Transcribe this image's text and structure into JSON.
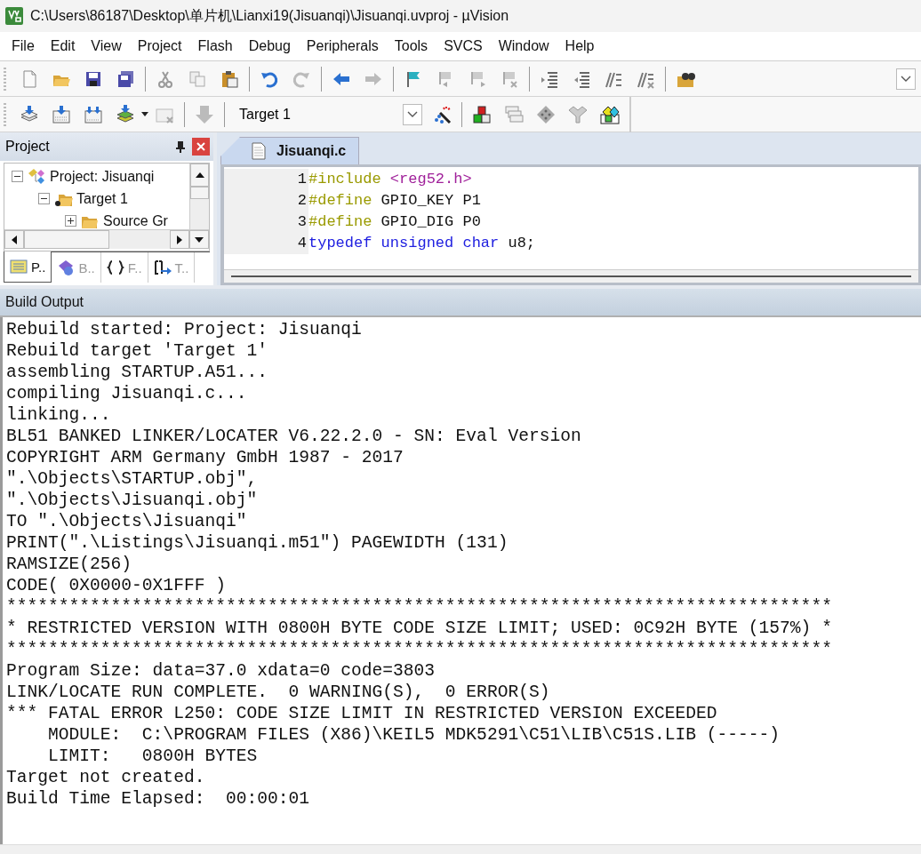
{
  "window": {
    "title": "C:\\Users\\86187\\Desktop\\单片机\\Lianxi19(Jisuanqi)\\Jisuanqi.uvproj - µVision"
  },
  "menu": [
    "File",
    "Edit",
    "View",
    "Project",
    "Flash",
    "Debug",
    "Peripherals",
    "Tools",
    "SVCS",
    "Window",
    "Help"
  ],
  "build_toolbar": {
    "target": "Target 1"
  },
  "project_panel": {
    "title": "Project",
    "tree": [
      {
        "label": "Project: Jisuanqi",
        "kind": "project",
        "expanded": true,
        "children": [
          {
            "label": "Target 1",
            "kind": "target",
            "expanded": true,
            "children": [
              {
                "label": "Source Gr",
                "kind": "group",
                "expanded": false
              }
            ]
          }
        ]
      }
    ],
    "tabs": [
      {
        "label": "P..",
        "kind": "project",
        "selected": true
      },
      {
        "label": "B..",
        "kind": "books",
        "selected": false
      },
      {
        "label": "F..",
        "kind": "functions",
        "selected": false
      },
      {
        "label": "T..",
        "kind": "templates",
        "selected": false
      }
    ]
  },
  "editor": {
    "tabs": [
      {
        "label": "Jisuanqi.c",
        "selected": true
      }
    ],
    "lines": [
      {
        "number": "1",
        "tokens": [
          {
            "text": "#include",
            "kind": "preprocessor"
          },
          {
            "text": " <reg52.h>",
            "kind": "string"
          }
        ]
      },
      {
        "number": "2",
        "tokens": [
          {
            "text": "#define",
            "kind": "preprocessor"
          },
          {
            "text": " GPIO_KEY P1",
            "kind": "plain"
          }
        ]
      },
      {
        "number": "3",
        "tokens": [
          {
            "text": "#define",
            "kind": "preprocessor"
          },
          {
            "text": " GPIO_DIG P0",
            "kind": "plain"
          }
        ]
      },
      {
        "number": "4",
        "tokens": [
          {
            "text": "typedef",
            "kind": "keyword"
          },
          {
            "text": " unsigned",
            "kind": "keyword"
          },
          {
            "text": " char",
            "kind": "keyword"
          },
          {
            "text": " u8;",
            "kind": "plain"
          }
        ]
      }
    ]
  },
  "build_output": {
    "title": "Build Output",
    "lines": [
      "Rebuild started: Project: Jisuanqi",
      "Rebuild target 'Target 1'",
      "assembling STARTUP.A51...",
      "compiling Jisuanqi.c...",
      "linking...",
      "BL51 BANKED LINKER/LOCATER V6.22.2.0 - SN: Eval Version",
      "COPYRIGHT ARM Germany GmbH 1987 - 2017",
      "\".\\Objects\\STARTUP.obj\",",
      "\".\\Objects\\Jisuanqi.obj\"",
      "TO \".\\Objects\\Jisuanqi\"",
      "PRINT(\".\\Listings\\Jisuanqi.m51\") PAGEWIDTH (131)",
      "RAMSIZE(256)",
      "CODE( 0X0000-0X1FFF )",
      "*******************************************************************************",
      "* RESTRICTED VERSION WITH 0800H BYTE CODE SIZE LIMIT; USED: 0C92H BYTE (157%) *",
      "*******************************************************************************",
      "Program Size: data=37.0 xdata=0 code=3803",
      "LINK/LOCATE RUN COMPLETE.  0 WARNING(S),  0 ERROR(S)",
      "*** FATAL ERROR L250: CODE SIZE LIMIT IN RESTRICTED VERSION EXCEEDED",
      "    MODULE:  C:\\PROGRAM FILES (X86)\\KEIL5 MDK5291\\C51\\LIB\\C51S.LIB (-----)",
      "    LIMIT:   0800H BYTES",
      "Target not created.",
      "Build Time Elapsed:  00:00:01"
    ]
  }
}
